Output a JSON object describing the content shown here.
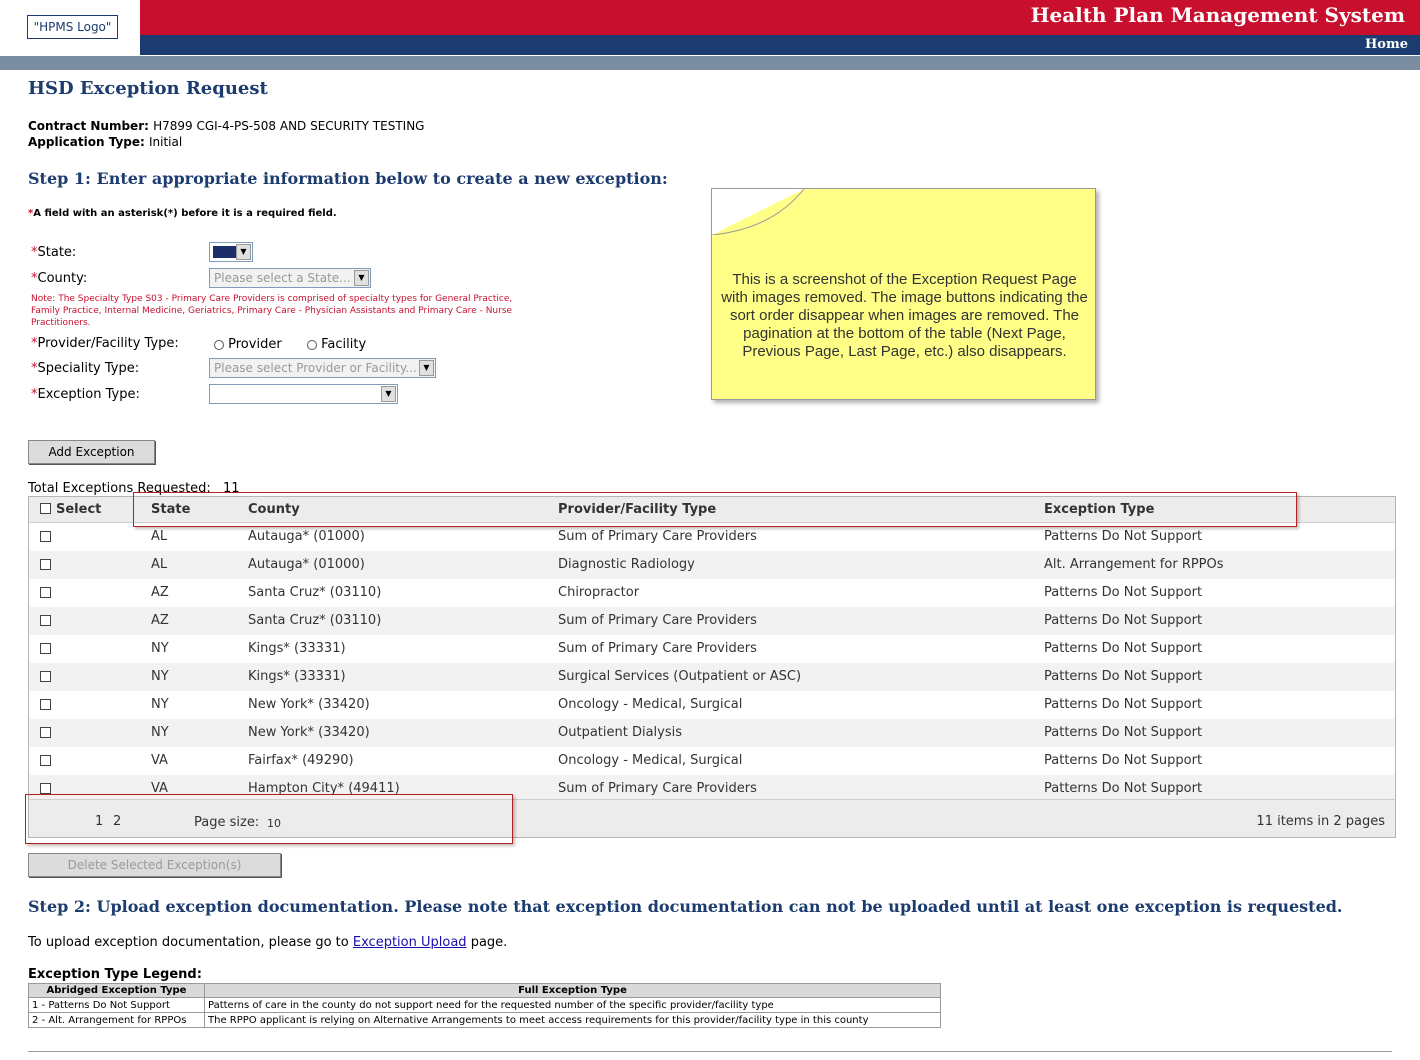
{
  "header": {
    "logo": "\"HPMS Logo\"",
    "title": "Health Plan Management System",
    "home": "Home"
  },
  "page": {
    "title": "HSD Exception Request",
    "contract_label": "Contract Number:",
    "contract_value": "H7899 CGI-4-PS-508 AND SECURITY TESTING",
    "app_type_label": "Application Type:",
    "app_type_value": "Initial"
  },
  "step1": {
    "title": "Step 1:  Enter appropriate information below to create a new exception:",
    "required_star": "*",
    "required_note": "A field with an asterisk(*) before it is a required field.",
    "star": "*",
    "state_label": "State:",
    "county_label": "County:",
    "county_placeholder": "Please select a State...",
    "specialty_note": "Note: The Specialty Type S03 - Primary Care Providers is comprised of specialty types for General Practice, Family Practice, Internal Medicine, Geriatrics, Primary Care - Physician Assistants and Primary Care - Nurse Practitioners.",
    "provider_type_label": "Provider/Facility Type:",
    "radio_provider": "Provider",
    "radio_facility": "Facility",
    "specialty_label": "Speciality Type:",
    "specialty_placeholder": "Please select Provider or Facility...",
    "exception_label": "Exception Type:",
    "exception_value": "",
    "add_button": "Add Exception"
  },
  "note": {
    "text": "This is a screenshot of the Exception Request Page with images removed. The image buttons indicating the sort order disappear when images are removed. The pagination at the bottom of the table (Next Page, Previous Page, Last Page, etc.) also disappears."
  },
  "grid": {
    "total_label": "Total Exceptions Requested:",
    "total_value": "11",
    "headers": [
      "Select",
      "State",
      "County",
      "Provider/Facility Type",
      "Exception Type"
    ],
    "rows": [
      [
        "AL",
        "Autauga* (01000)",
        "Sum of Primary Care Providers",
        "Patterns Do Not Support"
      ],
      [
        "AL",
        "Autauga* (01000)",
        "Diagnostic Radiology",
        "Alt. Arrangement for RPPOs"
      ],
      [
        "AZ",
        "Santa Cruz* (03110)",
        "Chiropractor",
        "Patterns Do Not Support"
      ],
      [
        "AZ",
        "Santa Cruz* (03110)",
        "Sum of Primary Care Providers",
        "Patterns Do Not Support"
      ],
      [
        "NY",
        "Kings* (33331)",
        "Sum of Primary Care Providers",
        "Patterns Do Not Support"
      ],
      [
        "NY",
        "Kings* (33331)",
        "Surgical Services (Outpatient or ASC)",
        "Patterns Do Not Support"
      ],
      [
        "NY",
        "New York* (33420)",
        "Oncology - Medical, Surgical",
        "Patterns Do Not Support"
      ],
      [
        "NY",
        "New York* (33420)",
        "Outpatient Dialysis",
        "Patterns Do Not Support"
      ],
      [
        "VA",
        "Fairfax* (49290)",
        "Oncology - Medical, Surgical",
        "Patterns Do Not Support"
      ],
      [
        "VA",
        "Hampton City* (49411)",
        "Sum of Primary Care Providers",
        "Patterns Do Not Support"
      ]
    ],
    "pager": {
      "page1": "1",
      "page2": "2",
      "page_size_label": "Page size:",
      "page_size_value": "10",
      "summary": "11 items in 2 pages"
    },
    "delete_button": "Delete Selected Exception(s)"
  },
  "step2": {
    "title": "Step 2:  Upload exception documentation. Please note that exception documentation can not be uploaded until at least one exception is requested.",
    "upload_prefix": "To upload exception documentation, please go to",
    "upload_link": "Exception Upload",
    "upload_suffix": "page."
  },
  "legend": {
    "title": "Exception Type Legend:",
    "col1": "Abridged Exception Type",
    "col2": "Full Exception Type",
    "rows": [
      [
        "1 - Patterns Do Not Support",
        "Patterns of care in the county do not support need for the requested number of the specific provider/facility type"
      ],
      [
        "2 - Alt. Arrangement for RPPOs",
        "The RPPO applicant is relying on Alternative Arrangements to meet access requirements for this provider/facility type in this county"
      ]
    ]
  },
  "colors": {
    "header_red": "#c8102e",
    "header_blue": "#1c3b6e",
    "header_gray": "#7b8da0",
    "note_yellow": "#ffff88",
    "highlight_red": "#b22222"
  }
}
